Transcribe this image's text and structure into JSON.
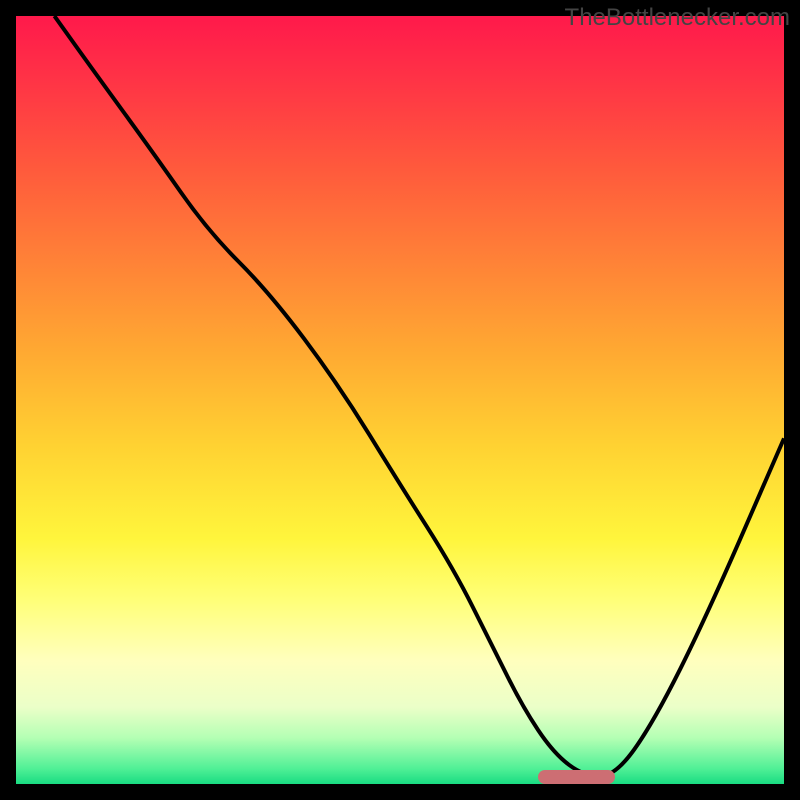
{
  "watermark": "TheBottlenecker.com",
  "chart_data": {
    "type": "line",
    "title": "",
    "xlabel": "",
    "ylabel": "",
    "xlim": [
      0,
      100
    ],
    "ylim": [
      0,
      100
    ],
    "curve": {
      "x": [
        5,
        10,
        18,
        25,
        33,
        42,
        50,
        57,
        62,
        66,
        70,
        74,
        78,
        83,
        90,
        100
      ],
      "y": [
        100,
        93,
        82,
        72,
        64,
        52,
        39,
        28,
        18,
        10,
        4,
        1,
        1,
        8,
        22,
        45
      ]
    },
    "optimal_zone": {
      "x_start": 68,
      "x_end": 78,
      "y": 0
    },
    "gradient_stops": [
      {
        "pos": 0,
        "color": "#ff194b"
      },
      {
        "pos": 50,
        "color": "#ffbf33"
      },
      {
        "pos": 80,
        "color": "#ffff90"
      },
      {
        "pos": 100,
        "color": "#19dc82"
      }
    ]
  }
}
